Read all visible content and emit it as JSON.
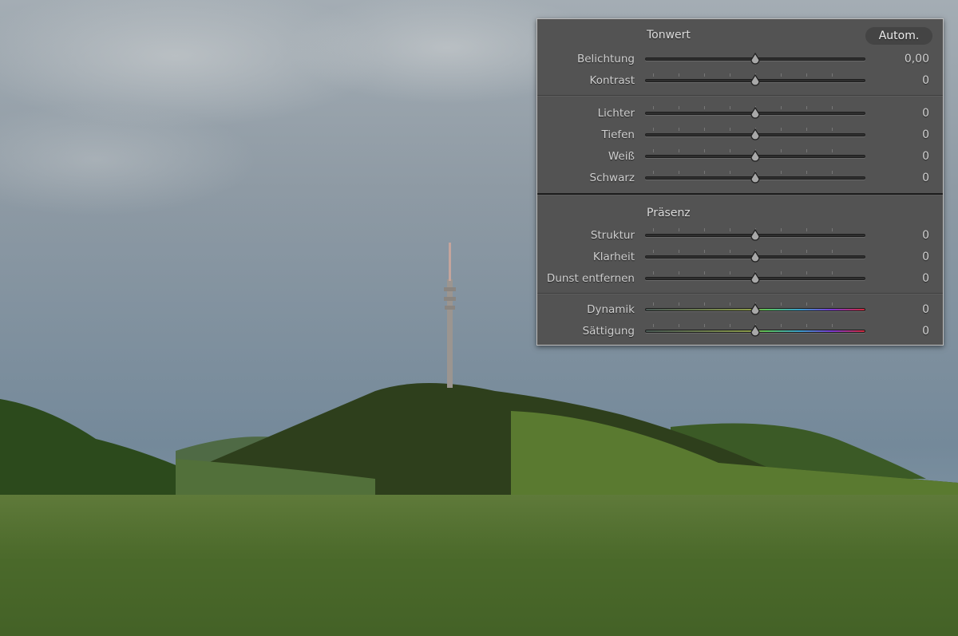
{
  "panel": {
    "tonwert": {
      "title": "Tonwert",
      "auto_label": "Autom."
    },
    "praesenz": {
      "title": "Präsenz"
    },
    "sliders": [
      {
        "label": "Belichtung",
        "value": "0,00",
        "position": 0.5,
        "ticks": false,
        "color": false
      },
      {
        "label": "Kontrast",
        "value": "0",
        "position": 0.5,
        "ticks": true,
        "color": false
      },
      {
        "label": "Lichter",
        "value": "0",
        "position": 0.5,
        "ticks": true,
        "color": false
      },
      {
        "label": "Tiefen",
        "value": "0",
        "position": 0.5,
        "ticks": true,
        "color": false
      },
      {
        "label": "Weiß",
        "value": "0",
        "position": 0.5,
        "ticks": true,
        "color": false
      },
      {
        "label": "Schwarz",
        "value": "0",
        "position": 0.5,
        "ticks": true,
        "color": false
      },
      {
        "label": "Struktur",
        "value": "0",
        "position": 0.5,
        "ticks": true,
        "color": false
      },
      {
        "label": "Klarheit",
        "value": "0",
        "position": 0.5,
        "ticks": true,
        "color": false
      },
      {
        "label": "Dunst entfernen",
        "value": "0",
        "position": 0.5,
        "ticks": true,
        "color": false
      },
      {
        "label": "Dynamik",
        "value": "0",
        "position": 0.5,
        "ticks": true,
        "color": true
      },
      {
        "label": "Sättigung",
        "value": "0",
        "position": 0.5,
        "ticks": true,
        "color": true
      }
    ]
  }
}
